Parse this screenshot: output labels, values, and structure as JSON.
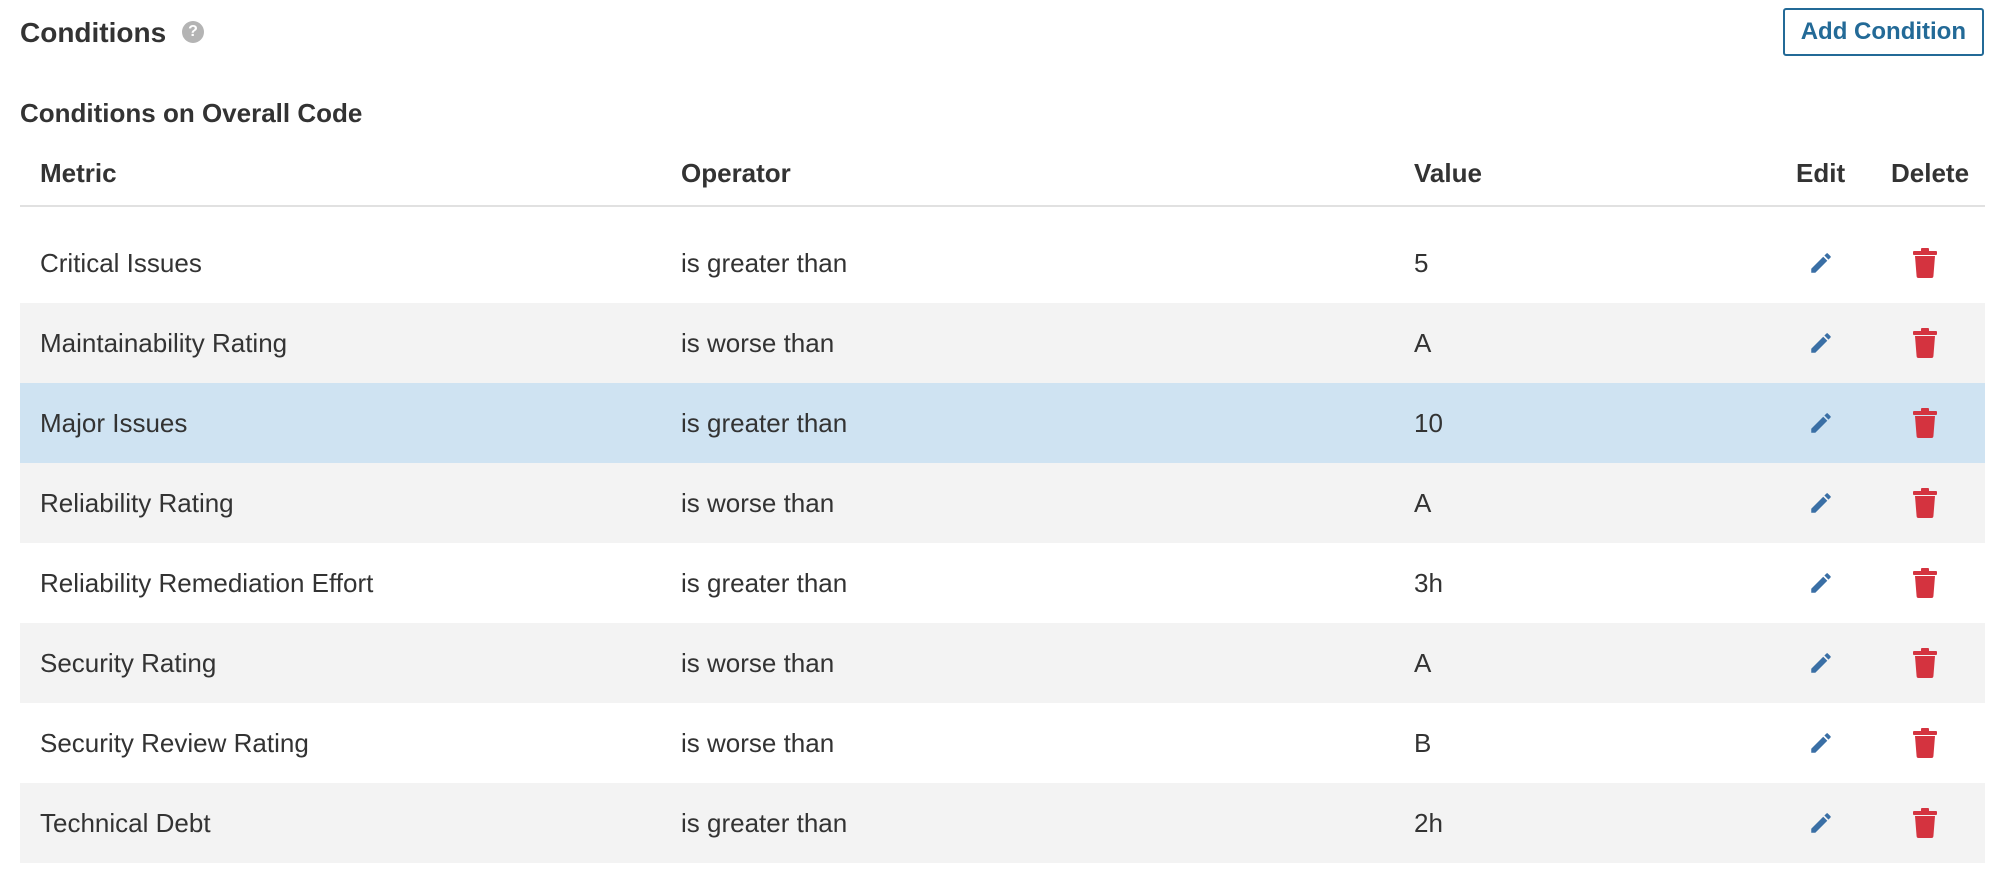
{
  "header": {
    "title": "Conditions",
    "help_icon": "question-circle-icon",
    "add_button_label": "Add Condition"
  },
  "section": {
    "title": "Conditions on Overall Code"
  },
  "table": {
    "columns": {
      "metric": "Metric",
      "operator": "Operator",
      "value": "Value",
      "edit": "Edit",
      "delete": "Delete"
    },
    "rows": [
      {
        "metric": "Critical Issues",
        "operator": "is greater than",
        "value": "5"
      },
      {
        "metric": "Maintainability Rating",
        "operator": "is worse than",
        "value": "A"
      },
      {
        "metric": "Major Issues",
        "operator": "is greater than",
        "value": "10"
      },
      {
        "metric": "Reliability Rating",
        "operator": "is worse than",
        "value": "A"
      },
      {
        "metric": "Reliability Remediation Effort",
        "operator": "is greater than",
        "value": "3h"
      },
      {
        "metric": "Security Rating",
        "operator": "is worse than",
        "value": "A"
      },
      {
        "metric": "Security Review Rating",
        "operator": "is worse than",
        "value": "B"
      },
      {
        "metric": "Technical Debt",
        "operator": "is greater than",
        "value": "2h"
      }
    ],
    "highlighted_row": 2,
    "icons": {
      "edit": "pencil-icon",
      "delete": "trash-icon"
    }
  },
  "colors": {
    "accent": "#236a97",
    "edit_icon": "#3a6fa5",
    "delete_icon": "#d4333f",
    "row_alt": "#f3f3f3",
    "row_highlight": "#cfe3f2"
  }
}
